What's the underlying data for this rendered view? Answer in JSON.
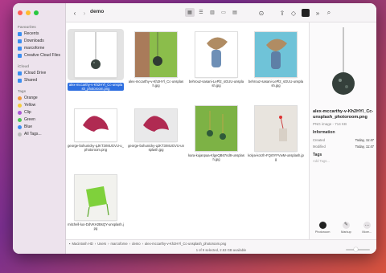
{
  "window": {
    "title": "demo"
  },
  "sidebar": {
    "sections": [
      {
        "label": "Favourites",
        "items": [
          "Recents",
          "Downloads",
          "marcoforne",
          "Creative Cloud Files"
        ]
      },
      {
        "label": "iCloud",
        "items": [
          "iCloud Drive",
          "Shared"
        ]
      },
      {
        "label": "Tags",
        "items": [
          "Orange",
          "Yellow",
          "Clip",
          "Green",
          "Blue",
          "All Tags..."
        ]
      }
    ],
    "tag_colors": {
      "Orange": "#f19a37",
      "Yellow": "#f5cc3a",
      "Clip": "#ab57d6",
      "Green": "#4bc553",
      "Blue": "#3d8ef0"
    }
  },
  "files": [
    {
      "name": "alex-mccarthy-v-Kh2HYl_Cc-unsplash_photoroom.png",
      "selected": true
    },
    {
      "name": "alex-mccarthy-v-Kh2HYl_Cc-unsplash.jpg"
    },
    {
      "name": "behrouz-sasani-LePl2_sGUU-unsplash.jpg"
    },
    {
      "name": "behrouz-sasani-LePl2_sGUU-unsplash.jpg"
    },
    {
      "name": "george-bohunicky-qJKT3rMUGVU-u_photoroom.png"
    },
    {
      "name": "george-bohunicky-qJKT3rMUGVU-unsplash.jpg"
    },
    {
      "name": "kara-kujanpaa-KlgeQB67nd8-unsplash.jpg"
    },
    {
      "name": "kolya-korzh-FQr0YFVwM-unsplash.jpg"
    },
    {
      "name": "mitchell-luo-DdVKH2BsQY-unsplash.jpg"
    }
  ],
  "preview": {
    "name": "alex-mccarthy-v-Kh2HYl_Cc-unsplash_photoroom.png",
    "kind": "PNG image - 714 KB",
    "info_heading": "Information",
    "created_label": "Created",
    "created_value": "Today, 11:47",
    "modified_label": "Modified",
    "modified_value": "Today, 11:47",
    "tags_heading": "Tags",
    "tags_placeholder": "Add Tags...",
    "actions": [
      "Photoroom",
      "Markup",
      "More..."
    ]
  },
  "pathbar": [
    "Macintosh HD",
    "Users",
    "marcoforne",
    "demo",
    "alex-mccarthy-v-Kh2HYl_Cc-unsplash_photoroom.png"
  ],
  "status": "1 of 9 selected, 2.53 GB available"
}
